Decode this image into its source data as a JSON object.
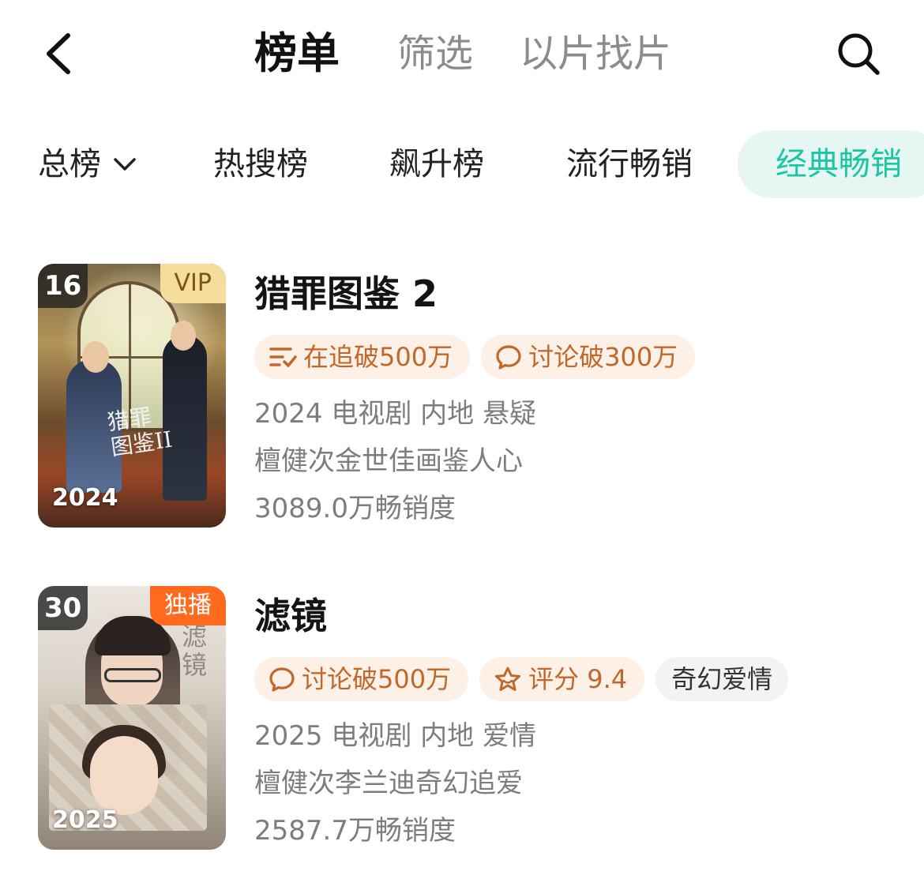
{
  "header": {
    "back_icon": "chevron-left-icon",
    "tabs": [
      {
        "label": "榜单",
        "active": true
      },
      {
        "label": "筛选",
        "active": false
      },
      {
        "label": "以片找片",
        "active": false
      }
    ],
    "search_icon": "search-icon"
  },
  "categories": {
    "dropdown_label": "总榜",
    "items": [
      {
        "label": "热搜榜"
      },
      {
        "label": "飙升榜"
      },
      {
        "label": "流行畅销"
      },
      {
        "label": "经典畅销",
        "active": true
      }
    ],
    "accent_color": "#1ac6a3"
  },
  "list": [
    {
      "rank": "16",
      "corner_tag": "VIP",
      "poster_year": "2024",
      "poster_title": "猎罪图鉴II",
      "title": "猎罪图鉴 2",
      "badges": [
        {
          "icon": "following-list-icon",
          "text": "在追破500万"
        },
        {
          "icon": "comment-icon",
          "text": "讨论破300万"
        }
      ],
      "meta": "2024 电视剧 内地 悬疑",
      "tagline": "檀健次金世佳画鉴人心",
      "sales": "3089.0万畅销度"
    },
    {
      "rank": "30",
      "corner_tag": "独播",
      "poster_year": "2025",
      "poster_title": "滤镜",
      "title": "滤镜",
      "badges": [
        {
          "icon": "comment-icon",
          "text": "讨论破500万"
        },
        {
          "icon": "star-icon",
          "text": "评分 9.4"
        },
        {
          "icon": "",
          "text": "奇幻爱情"
        }
      ],
      "meta": "2025 电视剧 内地 爱情",
      "tagline": "檀健次李兰迪奇幻追爱",
      "sales": "2587.7万畅销度"
    }
  ]
}
